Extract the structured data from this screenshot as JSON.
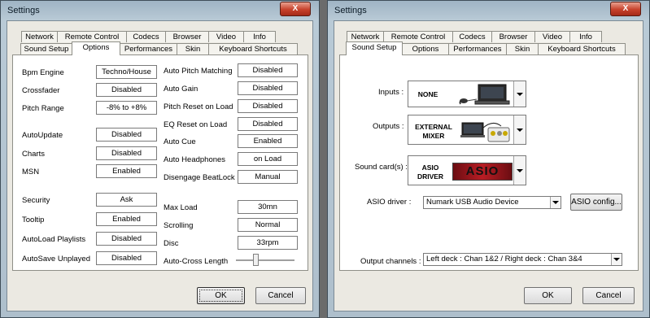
{
  "left_window": {
    "title": "Settings",
    "close_glyph": "X",
    "tabs_top": [
      "Network",
      "Remote Control",
      "Codecs",
      "Browser",
      "Video",
      "Info"
    ],
    "tabs_bottom": [
      "Sound Setup",
      "Options",
      "Performances",
      "Skin",
      "Keyboard Shortcuts"
    ],
    "selected_tab": "Options",
    "options_left": [
      {
        "label": "Bpm Engine",
        "value": "Techno/House"
      },
      {
        "label": "Crossfader",
        "value": "Disabled"
      },
      {
        "label": "Pitch Range",
        "value": "-8% to +8%"
      },
      {
        "label": "AutoUpdate",
        "value": "Disabled"
      },
      {
        "label": "Charts",
        "value": "Disabled"
      },
      {
        "label": "MSN",
        "value": "Enabled"
      },
      {
        "label": "Security",
        "value": "Ask"
      },
      {
        "label": "Tooltip",
        "value": "Enabled"
      },
      {
        "label": "AutoLoad Playlists",
        "value": "Disabled"
      },
      {
        "label": "AutoSave Unplayed",
        "value": "Disabled"
      }
    ],
    "options_right": [
      {
        "label": "Auto Pitch Matching",
        "value": "Disabled"
      },
      {
        "label": "Auto Gain",
        "value": "Disabled"
      },
      {
        "label": "Pitch Reset on Load",
        "value": "Disabled"
      },
      {
        "label": "EQ Reset on Load",
        "value": "Disabled"
      },
      {
        "label": "Auto Cue",
        "value": "Enabled"
      },
      {
        "label": "Auto Headphones",
        "value": "on Load"
      },
      {
        "label": "Disengage BeatLock",
        "value": "Manual"
      },
      {
        "label": "Max Load",
        "value": "30mn"
      },
      {
        "label": "Scrolling",
        "value": "Normal"
      },
      {
        "label": "Disc",
        "value": "33rpm"
      }
    ],
    "auto_cross_length": {
      "label": "Auto-Cross Length",
      "level": 0.33
    },
    "ok_label": "OK",
    "cancel_label": "Cancel"
  },
  "right_window": {
    "title": "Settings",
    "close_glyph": "X",
    "tabs_top": [
      "Network",
      "Remote Control",
      "Codecs",
      "Browser",
      "Video",
      "Info"
    ],
    "tabs_bottom": [
      "Sound Setup",
      "Options",
      "Performances",
      "Skin",
      "Keyboard Shortcuts"
    ],
    "selected_tab": "Sound Setup",
    "inputs": {
      "label": "Inputs :",
      "value": "NONE"
    },
    "outputs": {
      "label": "Outputs :",
      "value_line1": "EXTERNAL",
      "value_line2": "MIXER"
    },
    "sound_cards": {
      "label": "Sound card(s) :",
      "value_line1": "ASIO",
      "value_line2": "DRIVER",
      "logo_text": "ASIO"
    },
    "asio_driver": {
      "label": "ASIO driver :",
      "value": "Numark USB Audio Device"
    },
    "asio_config_label": "ASIO config...",
    "output_channels": {
      "label": "Output channels :",
      "value": "Left deck : Chan 1&2 / Right deck : Chan 3&4"
    },
    "ok_label": "OK",
    "cancel_label": "Cancel"
  }
}
